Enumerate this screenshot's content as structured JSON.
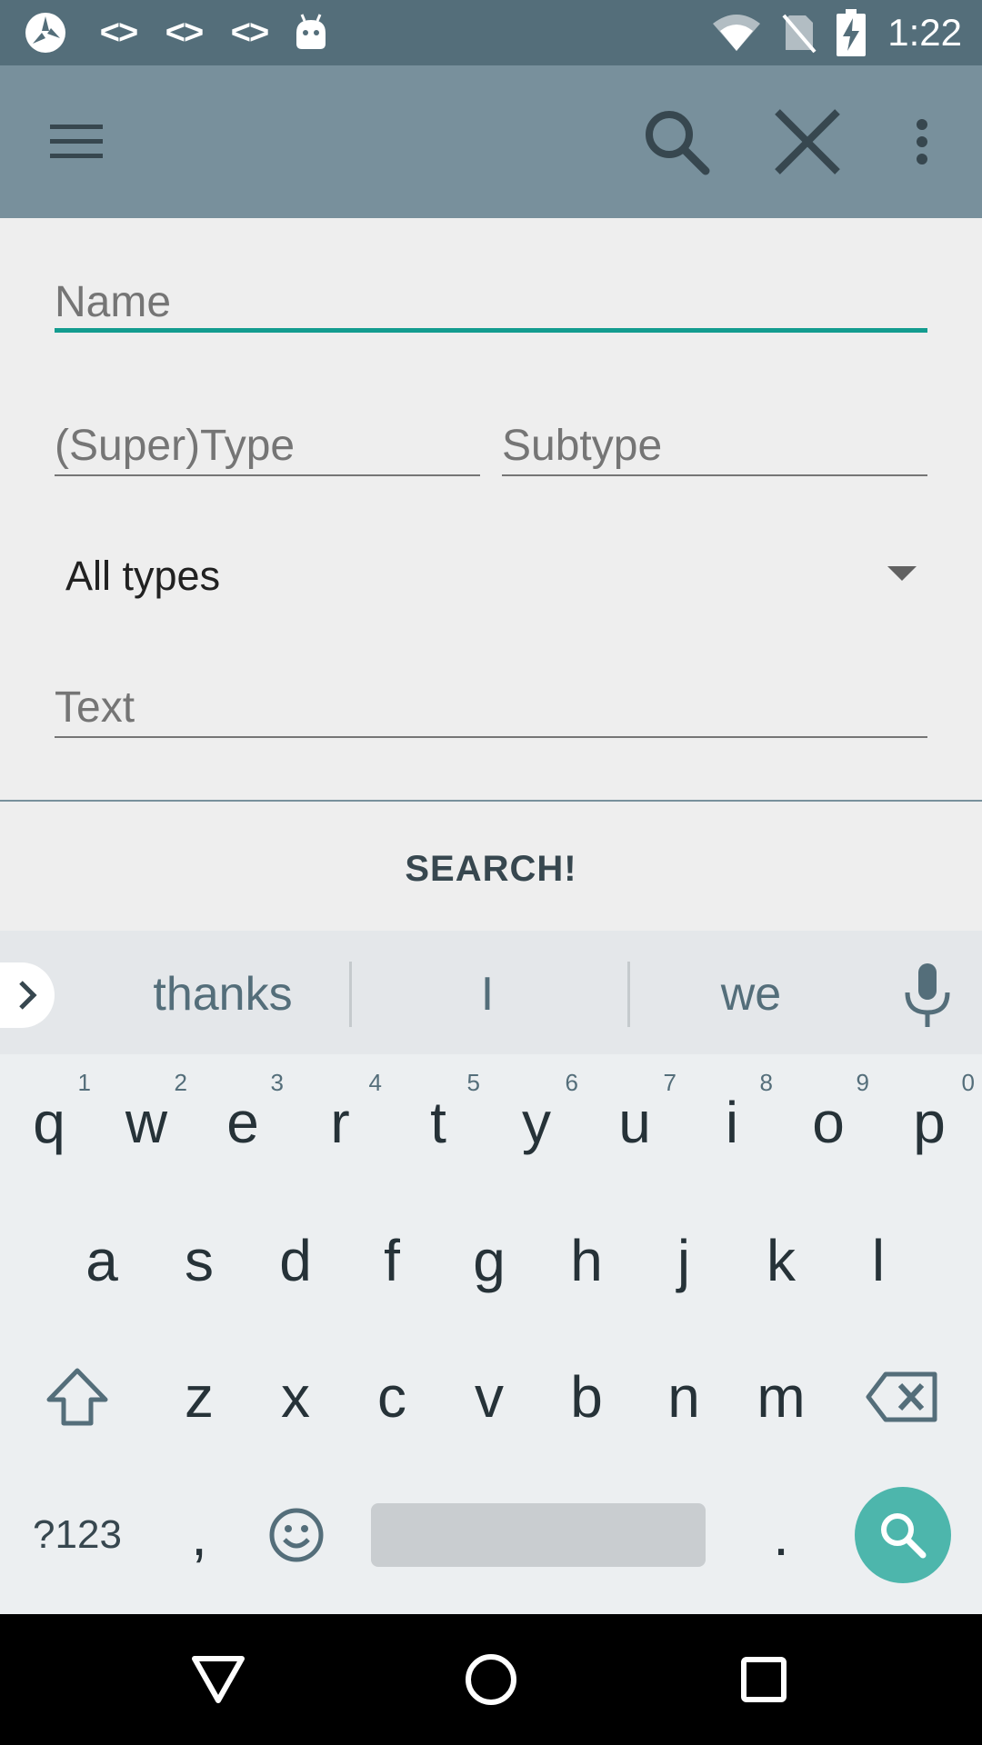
{
  "status_bar": {
    "time": "1:22",
    "left_icons": [
      "app-logo-icon",
      "code-icon",
      "code-icon",
      "code-icon",
      "android-icon"
    ],
    "code_glyph": "<>",
    "right_icons": [
      "wifi-icon",
      "no-sim-icon",
      "battery-charging-icon"
    ]
  },
  "toolbar": {
    "icons": [
      "menu-icon",
      "search-icon",
      "close-icon",
      "more-vert-icon"
    ]
  },
  "form": {
    "name_placeholder": "Name",
    "supertype_placeholder": "(Super)Type",
    "subtype_placeholder": "Subtype",
    "type_spinner_value": "All types",
    "text_placeholder": "Text",
    "search_button_label": "SEARCH!"
  },
  "keyboard": {
    "suggestions": [
      "thanks",
      "I",
      "we"
    ],
    "row1": [
      {
        "key": "q",
        "hint": "1"
      },
      {
        "key": "w",
        "hint": "2"
      },
      {
        "key": "e",
        "hint": "3"
      },
      {
        "key": "r",
        "hint": "4"
      },
      {
        "key": "t",
        "hint": "5"
      },
      {
        "key": "y",
        "hint": "6"
      },
      {
        "key": "u",
        "hint": "7"
      },
      {
        "key": "i",
        "hint": "8"
      },
      {
        "key": "o",
        "hint": "9"
      },
      {
        "key": "p",
        "hint": "0"
      }
    ],
    "row2": [
      "a",
      "s",
      "d",
      "f",
      "g",
      "h",
      "j",
      "k",
      "l"
    ],
    "row3": [
      "z",
      "x",
      "c",
      "v",
      "b",
      "n",
      "m"
    ],
    "symbols_label": "?123",
    "comma_label": ",",
    "period_label": "."
  },
  "nav_bar": {
    "icons": [
      "back-icon",
      "home-icon",
      "recents-icon"
    ]
  },
  "colors": {
    "status_bar": "#546e7a",
    "toolbar": "#78909c",
    "accent": "#139c8f",
    "search_key": "#4db6ac"
  }
}
